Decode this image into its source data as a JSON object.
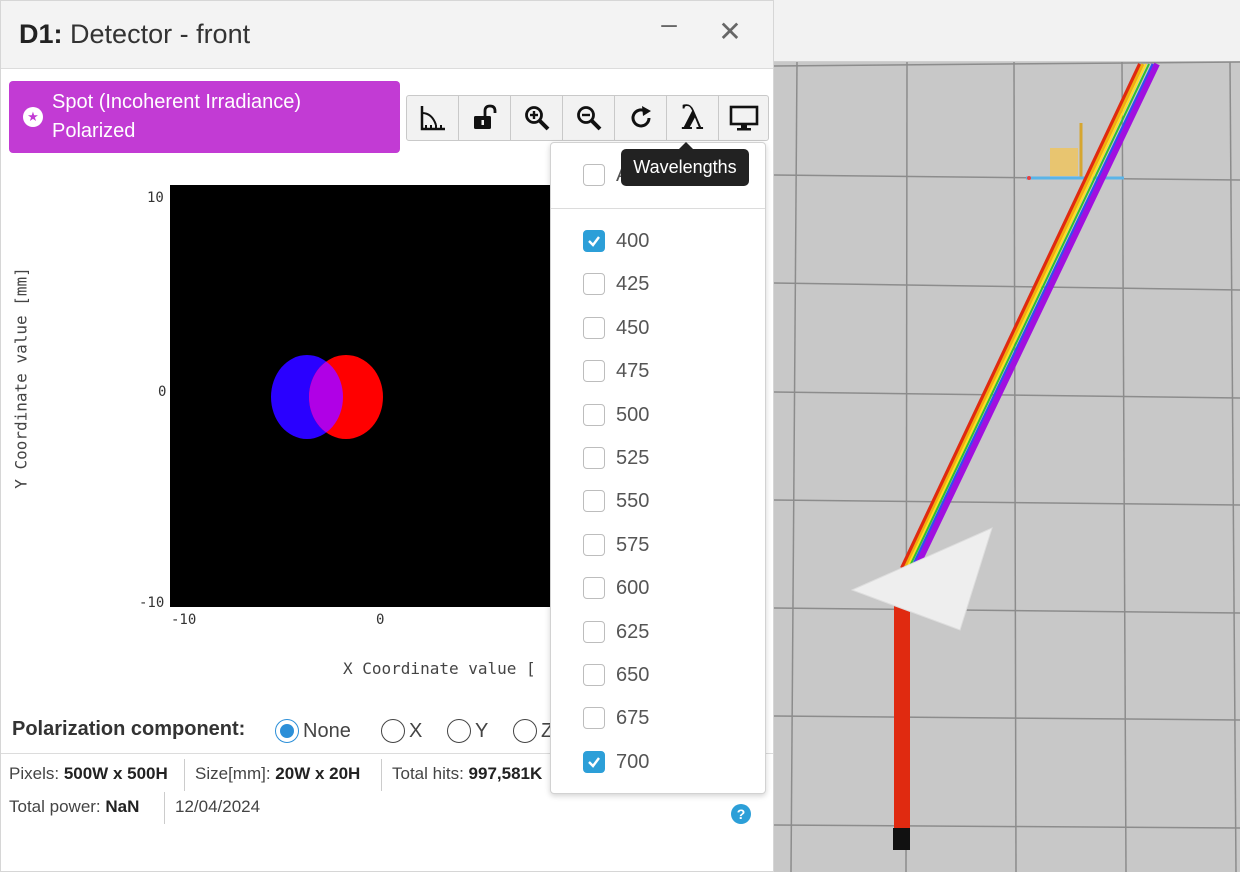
{
  "window": {
    "title_id": "D1:",
    "title_name": "Detector - front",
    "minimize": "–",
    "close": "✕"
  },
  "mode": {
    "line1": "Spot (Incoherent Irradiance)",
    "line2": "Polarized",
    "icon": "star-circle-icon",
    "color": "#c23bd4"
  },
  "toolbar": {
    "lambda": "λ",
    "tools": [
      "ruler-icon",
      "unlock-icon",
      "zoom-in-icon",
      "zoom-out-icon",
      "refresh-icon",
      "wavelength-icon",
      "monitor-icon"
    ]
  },
  "plot": {
    "y_label": "Y Coordinate value [mm]",
    "x_label": "X Coordinate value [",
    "y_ticks": [
      "10",
      "0",
      "-10"
    ],
    "x_ticks": [
      "-10",
      "0"
    ],
    "spots": [
      {
        "color": "#2a00ff",
        "label": "400"
      },
      {
        "color": "#ff0000",
        "label": "700"
      }
    ]
  },
  "polarization": {
    "label": "Polarization component:",
    "options": [
      "None",
      "X",
      "Y",
      "Z"
    ],
    "selected": "None"
  },
  "status": {
    "pixels_label": "Pixels:",
    "pixels_value": "500W x 500H",
    "size_label": "Size[mm]:",
    "size_value": "20W x 20H",
    "hits_label": "Total hits:",
    "hits_value": "997,581K",
    "power_label": "Total power:",
    "power_value": "NaN",
    "date": "12/04/2024",
    "help": "?"
  },
  "wavelengths": {
    "tooltip": "Wavelengths",
    "all_label": "All",
    "items": [
      {
        "label": "400",
        "checked": true
      },
      {
        "label": "425",
        "checked": false
      },
      {
        "label": "450",
        "checked": false
      },
      {
        "label": "475",
        "checked": false
      },
      {
        "label": "500",
        "checked": false
      },
      {
        "label": "525",
        "checked": false
      },
      {
        "label": "550",
        "checked": false
      },
      {
        "label": "575",
        "checked": false
      },
      {
        "label": "600",
        "checked": false
      },
      {
        "label": "625",
        "checked": false
      },
      {
        "label": "650",
        "checked": false
      },
      {
        "label": "675",
        "checked": false
      },
      {
        "label": "700",
        "checked": true
      }
    ]
  },
  "colors": {
    "accent": "#2c9fd8",
    "badge": "#c23bd4"
  }
}
